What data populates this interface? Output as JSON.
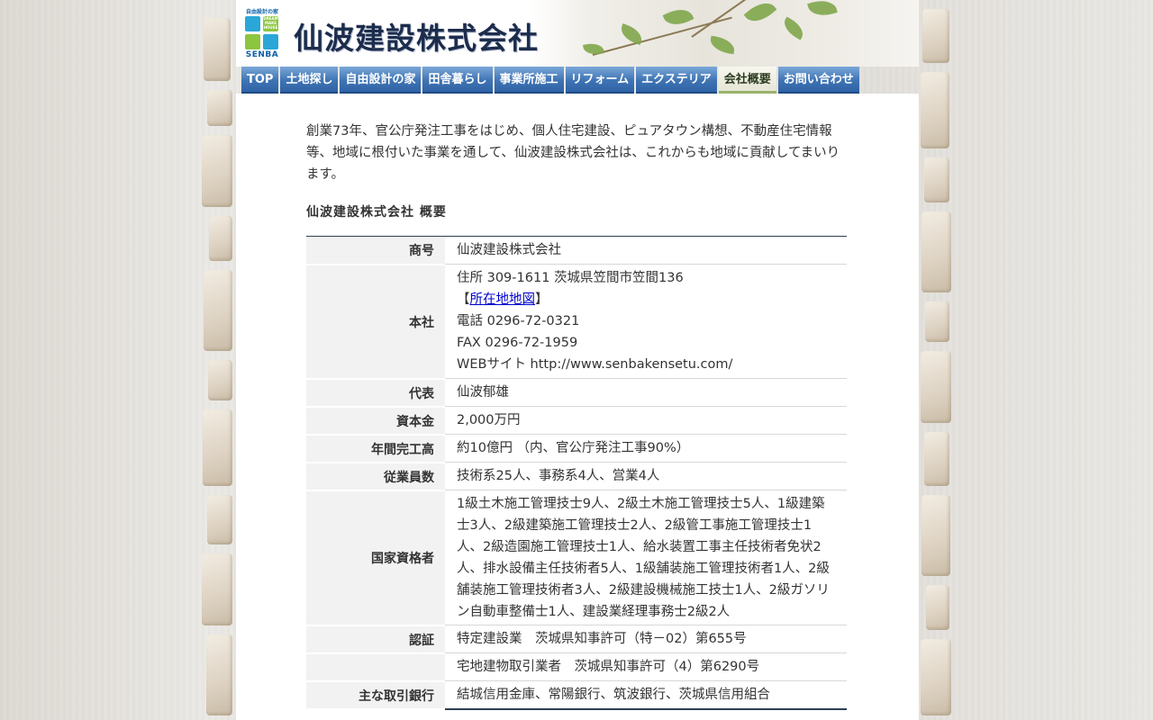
{
  "header": {
    "logo_top_text": "自由設計の家",
    "logo_square_text": "DREAM MAKE HOUSE",
    "logo_brand": "SENBA",
    "company_name": "仙波建設株式会社"
  },
  "nav": {
    "items": [
      {
        "label": "TOP"
      },
      {
        "label": "土地探し"
      },
      {
        "label": "自由設計の家"
      },
      {
        "label": "田舎暮らし"
      },
      {
        "label": "事業所施工"
      },
      {
        "label": "リフォーム"
      },
      {
        "label": "エクステリア"
      },
      {
        "label": "会社概要",
        "active": true
      },
      {
        "label": "お問い合わせ"
      }
    ]
  },
  "main": {
    "intro": "創業73年、官公庁発注工事をはじめ、個人住宅建設、ピュアタウン構想、不動産住宅情報等、地域に根付いた事業を通して、仙波建設株式会社は、これからも地域に貢献してまいります。",
    "section_title": "仙波建設株式会社 概要",
    "profile": {
      "trade_name": {
        "label": "商号",
        "value": "仙波建設株式会社"
      },
      "head_office": {
        "label": "本社",
        "address": "住所 309-1611 茨城県笠間市笠間136",
        "map_open": "【",
        "map_link": "所在地地図",
        "map_close": "】",
        "phone": "電話 0296-72-0321",
        "fax": "FAX 0296-72-1959",
        "website": "WEBサイト http://www.senbakensetu.com/"
      },
      "representative": {
        "label": "代表",
        "value": "仙波郁雄"
      },
      "capital": {
        "label": "資本金",
        "value": "2,000万円"
      },
      "annual_revenue": {
        "label": "年間完工高",
        "value": "約10億円 （内、官公庁発注工事90%）"
      },
      "employees": {
        "label": "従業員数",
        "value": "技術系25人、事務系4人、営業4人"
      },
      "qualifications": {
        "label": "国家資格者",
        "value": "1級土木施工管理技士9人、2級土木施工管理技士5人、1級建築士3人、2級建築施工管理技士2人、2級管工事施工管理技士1人、2級造園施工管理技士1人、給水装置工事主任技術者免状2人、排水設備主任技術者5人、1級舗装施工管理技術者1人、2級舗装施工管理技術者3人、2級建設機械施工技士1人、2級ガソリン自動車整備士1人、建設業経理事務士2級2人"
      },
      "certification": {
        "label": "認証",
        "value1": "特定建設業　茨城県知事許可（特－02）第655号",
        "value2": "宅地建物取引業者　茨城県知事許可（4）第6290号"
      },
      "banks": {
        "label": "主な取引銀行",
        "value": "結城信用金庫、常陽銀行、筑波銀行、茨城県信用組合"
      }
    }
  },
  "colors": {
    "nav_blue": "#3f74b4",
    "nav_active_bg": "#eeeee2",
    "table_rule": "#2d3f52",
    "link": "#0000cc",
    "logo_blue": "#0a5fa8"
  }
}
